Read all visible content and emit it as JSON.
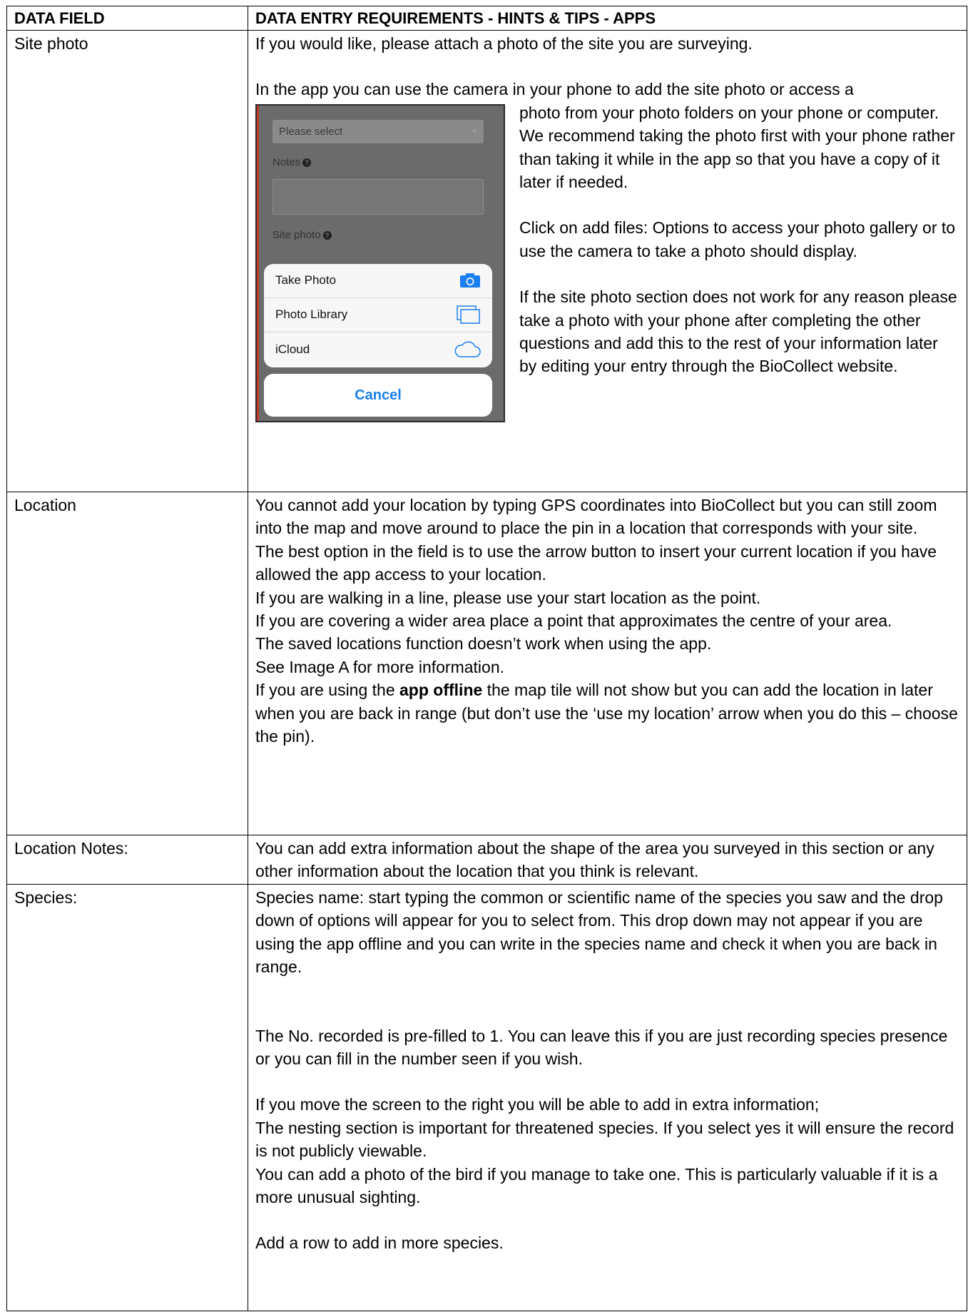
{
  "header": {
    "col1": "DATA FIELD",
    "col2": "DATA ENTRY REQUIREMENTS -  HINTS & TIPS - APPS"
  },
  "site_photo": {
    "field": "Site photo",
    "p1": "If you would like, please attach a photo of the site you are surveying.",
    "p2": "In the app you can use the camera in your phone to add the site photo or access a",
    "p3": "photo from your photo folders on your phone or computer.  We recommend taking the photo first with your phone rather than taking it while in the app so that you have a copy of it later if needed.",
    "p4": "Click on add files: Options to access your photo gallery or to use the camera to take a photo should display.",
    "p5": "If the site photo section does not work for any reason please take a photo with your phone after completing the other questions and add this to the rest of your information later by editing your entry through the BioCollect website.",
    "screenshot": {
      "select_placeholder": "Please select",
      "notes_label": "Notes",
      "site_photo_label": "Site photo",
      "options": [
        "Take Photo",
        "Photo Library",
        "iCloud"
      ],
      "option_icons": [
        "camera-icon",
        "photo-library-icon",
        "cloud-icon"
      ],
      "cancel": "Cancel",
      "accent": "#1a7ff0"
    }
  },
  "location": {
    "field": "Location",
    "lines": [
      "You cannot add your location by typing GPS coordinates into BioCollect but you can still zoom into the map and move around to place the pin in a location that corresponds with your site.",
      "The best option in the field is to use the arrow button to insert your current location if you have allowed the app access to your location.",
      "If you are walking in a line, please use your start location as the point.",
      "If you are covering a wider area place a point that approximates the centre of your area.",
      "The saved locations function doesn’t work when using the app.",
      "See Image A for more information."
    ],
    "offline_pre": "If you are using the ",
    "offline_bold": "app offline",
    "offline_post": " the map tile will not show but you can add the location in later when you are back in range (but don’t use the ‘use my location’ arrow when you do this – choose the pin)."
  },
  "location_notes": {
    "field": "Location Notes:",
    "text": "You can add extra information about the shape of the area you surveyed in this section or any other information about the location that you think is relevant."
  },
  "species": {
    "field": "Species:",
    "p1": "Species name: start typing the common or scientific name of the species you saw and the drop down of options will appear for you to select from.  This drop down may not appear if you are using the app offline and you can write in the species name and check it when you are back in range.",
    "p2": "The No. recorded is pre-filled to 1.  You can leave this if you are just recording species presence or you can fill in the number seen if you wish.",
    "p3": "If you move the screen to the right you will be able to add in extra information;",
    "p4": "The nesting section is important for threatened species.  If you select yes it will ensure the record is not publicly viewable.",
    "p5": "You can add a photo of the bird if you manage to take one.  This is particularly valuable if it is a more unusual sighting.",
    "p6": "Add a row to add in more species."
  }
}
